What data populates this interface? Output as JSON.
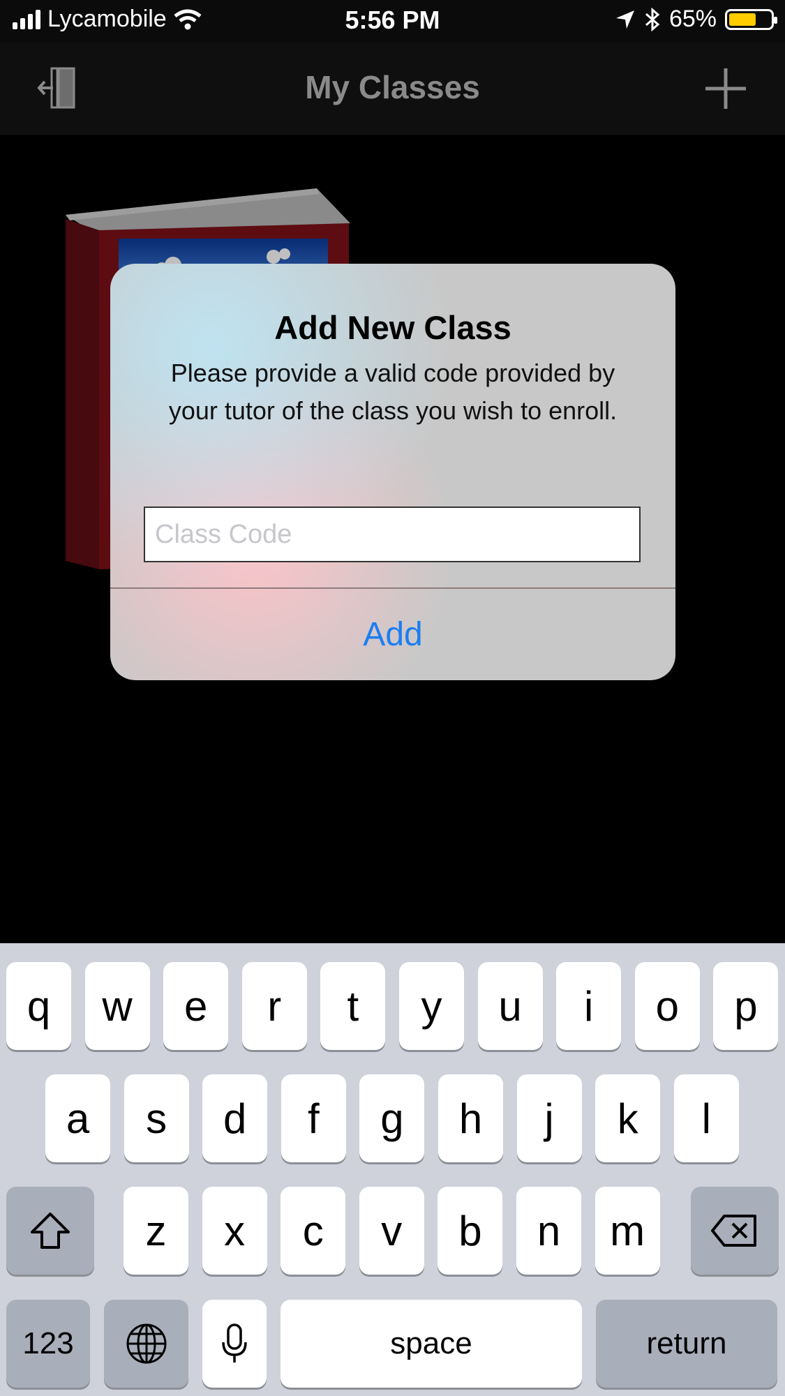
{
  "status_bar": {
    "carrier": "Lycamobile",
    "time": "5:56 PM",
    "battery_percent": "65%",
    "battery_level": 0.65,
    "battery_color": "#ffcc00"
  },
  "nav": {
    "title": "My Classes",
    "left_icon": "exit-door-icon",
    "right_icon": "plus-icon"
  },
  "alert": {
    "title": "Add New Class",
    "message": "Please provide a valid code provided by your tutor of the class you wish to enroll.",
    "input": {
      "placeholder": "Class Code",
      "value": ""
    },
    "add_label": "Add",
    "accent_color": "#1a7ef2"
  },
  "keyboard": {
    "row1": [
      "q",
      "w",
      "e",
      "r",
      "t",
      "y",
      "u",
      "i",
      "o",
      "p"
    ],
    "row2": [
      "a",
      "s",
      "d",
      "f",
      "g",
      "h",
      "j",
      "k",
      "l"
    ],
    "row3": [
      "z",
      "x",
      "c",
      "v",
      "b",
      "n",
      "m"
    ],
    "numbers_label": "123",
    "space_label": "space",
    "return_label": "return",
    "icons": [
      "shift-icon",
      "backspace-icon",
      "globe-icon",
      "microphone-icon"
    ]
  }
}
